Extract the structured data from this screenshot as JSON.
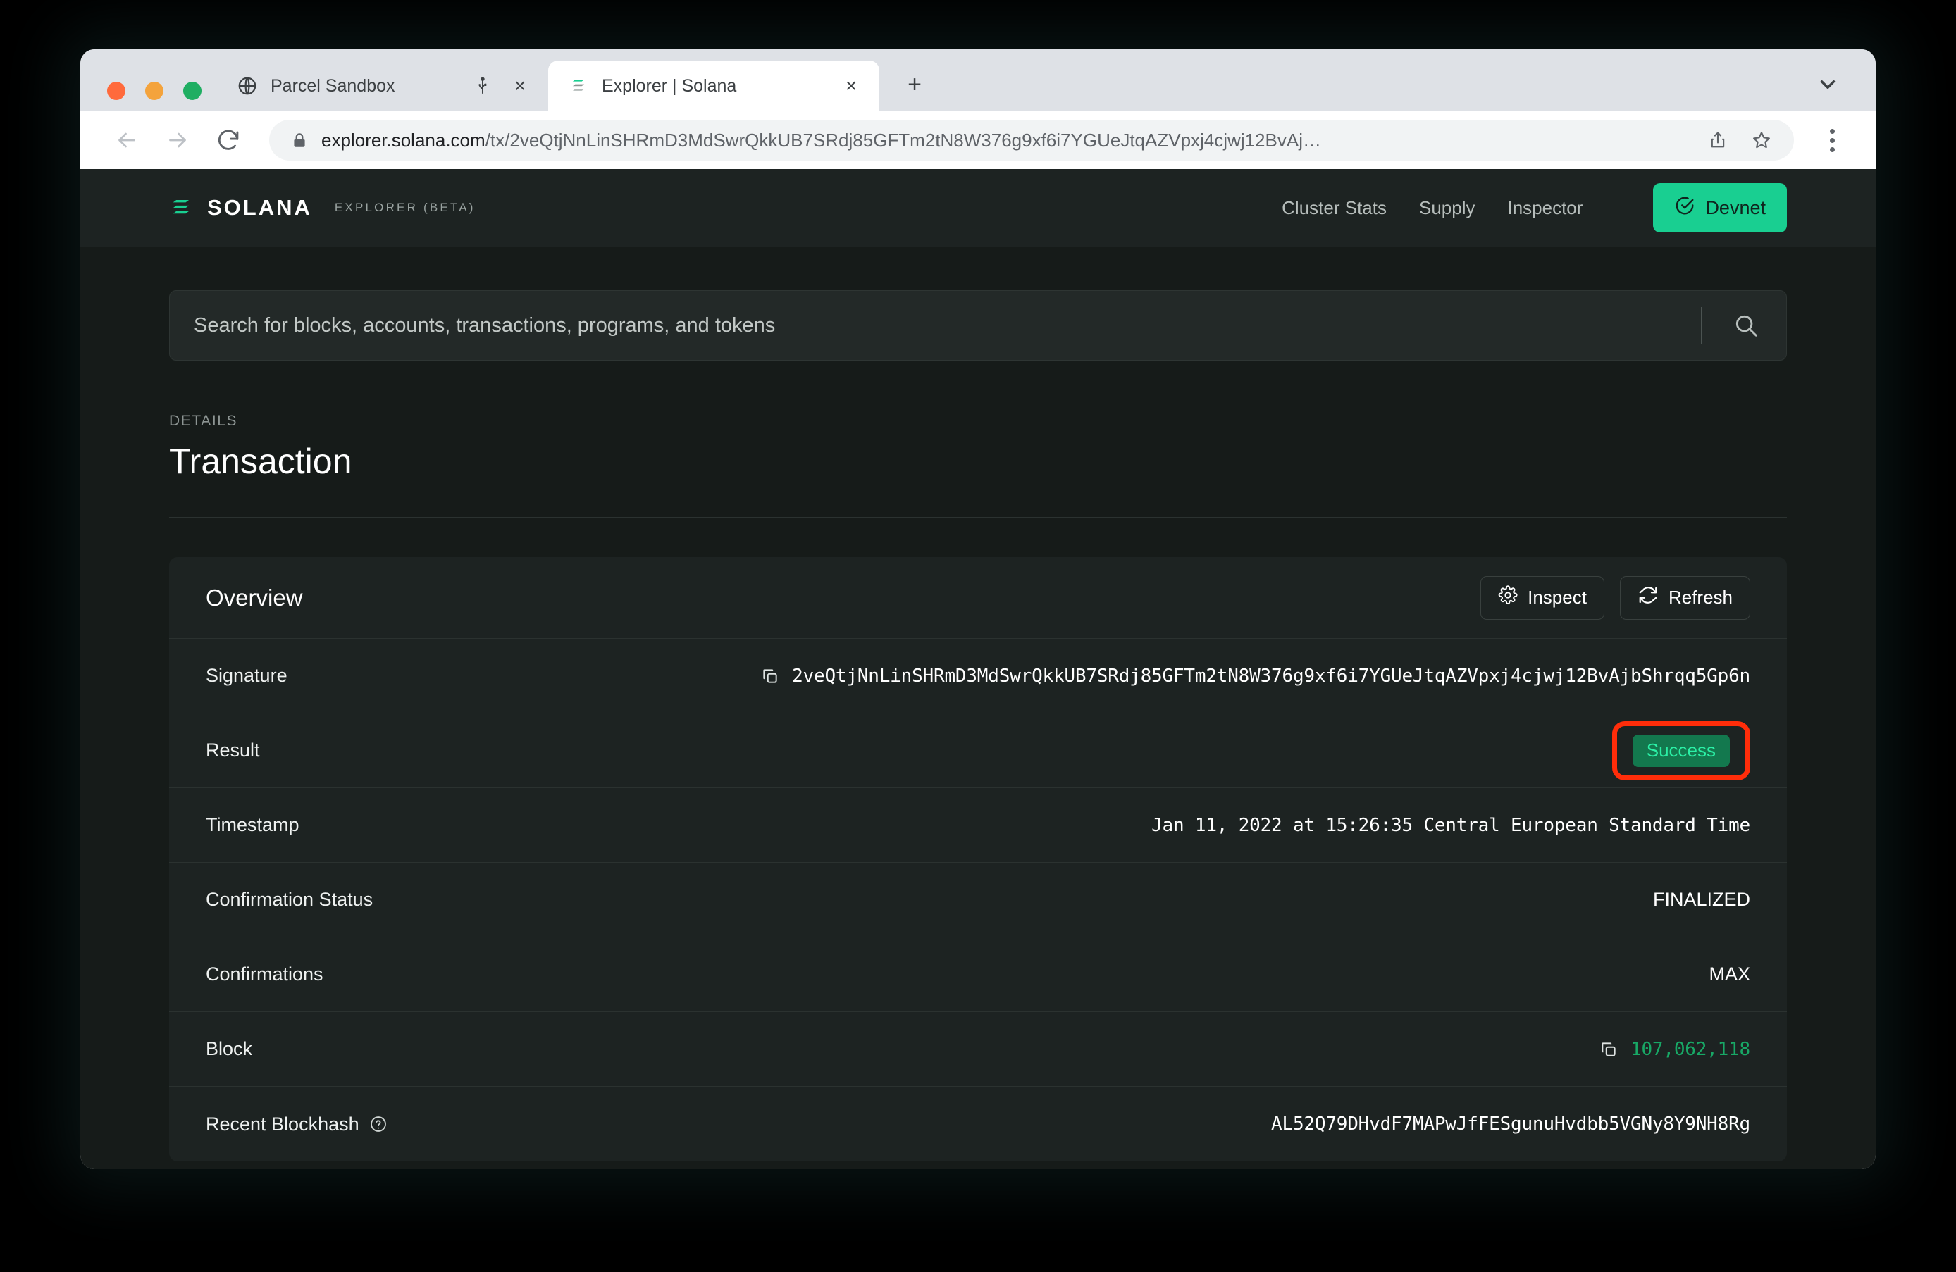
{
  "browser": {
    "tabs": [
      {
        "title": "Parcel Sandbox",
        "favicon": "globe-icon",
        "active": false
      },
      {
        "title": "Explorer | Solana",
        "favicon": "solana-icon",
        "active": true
      }
    ],
    "newtab_label": "+",
    "close_label": "×",
    "url_host": "explorer.solana.com",
    "url_path": "/tx/2veQtjNnLinSHRmD3MdSwrQkkUB7SRdj85GFTm2tN8W376g9xf6i7YGUeJtqAZVpxj4cjwj12BvAj…"
  },
  "header": {
    "brand_name": "SOLANA",
    "brand_sub": "EXPLORER (BETA)",
    "nav": [
      {
        "label": "Cluster Stats"
      },
      {
        "label": "Supply"
      },
      {
        "label": "Inspector"
      }
    ],
    "cluster_label": "Devnet",
    "cluster_color": "#19cf91"
  },
  "search": {
    "placeholder": "Search for blocks, accounts, transactions, programs, and tokens"
  },
  "details": {
    "eyebrow": "DETAILS",
    "title": "Transaction"
  },
  "overview": {
    "title": "Overview",
    "inspect_label": "Inspect",
    "refresh_label": "Refresh",
    "rows": [
      {
        "label": "Signature",
        "value": "2veQtjNnLinSHRmD3MdSwrQkkUB7SRdj85GFTm2tN8W376g9xf6i7YGUeJtqAZVpxj4cjwj12BvAjbShrqq5Gp6n"
      },
      {
        "label": "Result",
        "value": "Success"
      },
      {
        "label": "Timestamp",
        "value": "Jan 11, 2022 at 15:26:35 Central European Standard Time"
      },
      {
        "label": "Confirmation Status",
        "value": "FINALIZED"
      },
      {
        "label": "Confirmations",
        "value": "MAX"
      },
      {
        "label": "Block",
        "value": "107,062,118"
      },
      {
        "label": "Recent Blockhash",
        "value": "AL52Q79DHvdF7MAPwJfFESgunuHvdbb5VGNy8Y9NH8Rg"
      }
    ]
  },
  "annotation": {
    "color": "#ff2d0a",
    "target": "Success"
  }
}
